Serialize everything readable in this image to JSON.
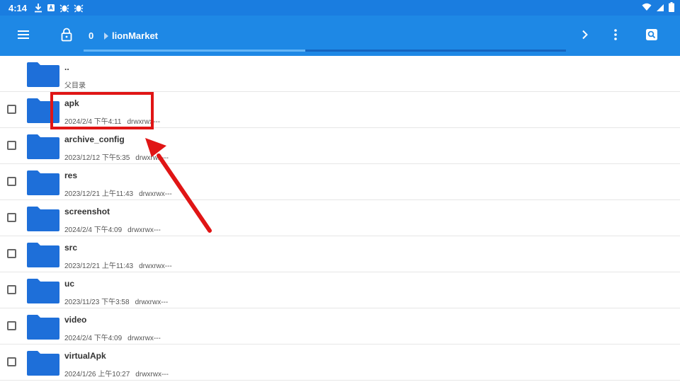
{
  "status_bar": {
    "time": "4:14"
  },
  "toolbar": {
    "count": "0",
    "path": "lionMarket",
    "progress": 0.46
  },
  "parent_row": {
    "name": "..",
    "label": "父目录"
  },
  "files": [
    {
      "name": "apk",
      "date": "2024/2/4 下午4:11",
      "perm": "drwxrwx---"
    },
    {
      "name": "archive_config",
      "date": "2023/12/12 下午5:35",
      "perm": "drwxrwx---"
    },
    {
      "name": "res",
      "date": "2023/12/21 上午11:43",
      "perm": "drwxrwx---"
    },
    {
      "name": "screenshot",
      "date": "2024/2/4 下午4:09",
      "perm": "drwxrwx---"
    },
    {
      "name": "src",
      "date": "2023/12/21 上午11:43",
      "perm": "drwxrwx---"
    },
    {
      "name": "uc",
      "date": "2023/11/23 下午3:58",
      "perm": "drwxrwx---"
    },
    {
      "name": "video",
      "date": "2024/2/4 下午4:09",
      "perm": "drwxrwx---"
    },
    {
      "name": "virtualApk",
      "date": "2024/1/26 上午10:27",
      "perm": "drwxrwx---"
    }
  ],
  "colors": {
    "toolbar": "#1e88e5",
    "status": "#1a7de0",
    "folder": "#1e6fd9",
    "annotation": "#e01515"
  }
}
